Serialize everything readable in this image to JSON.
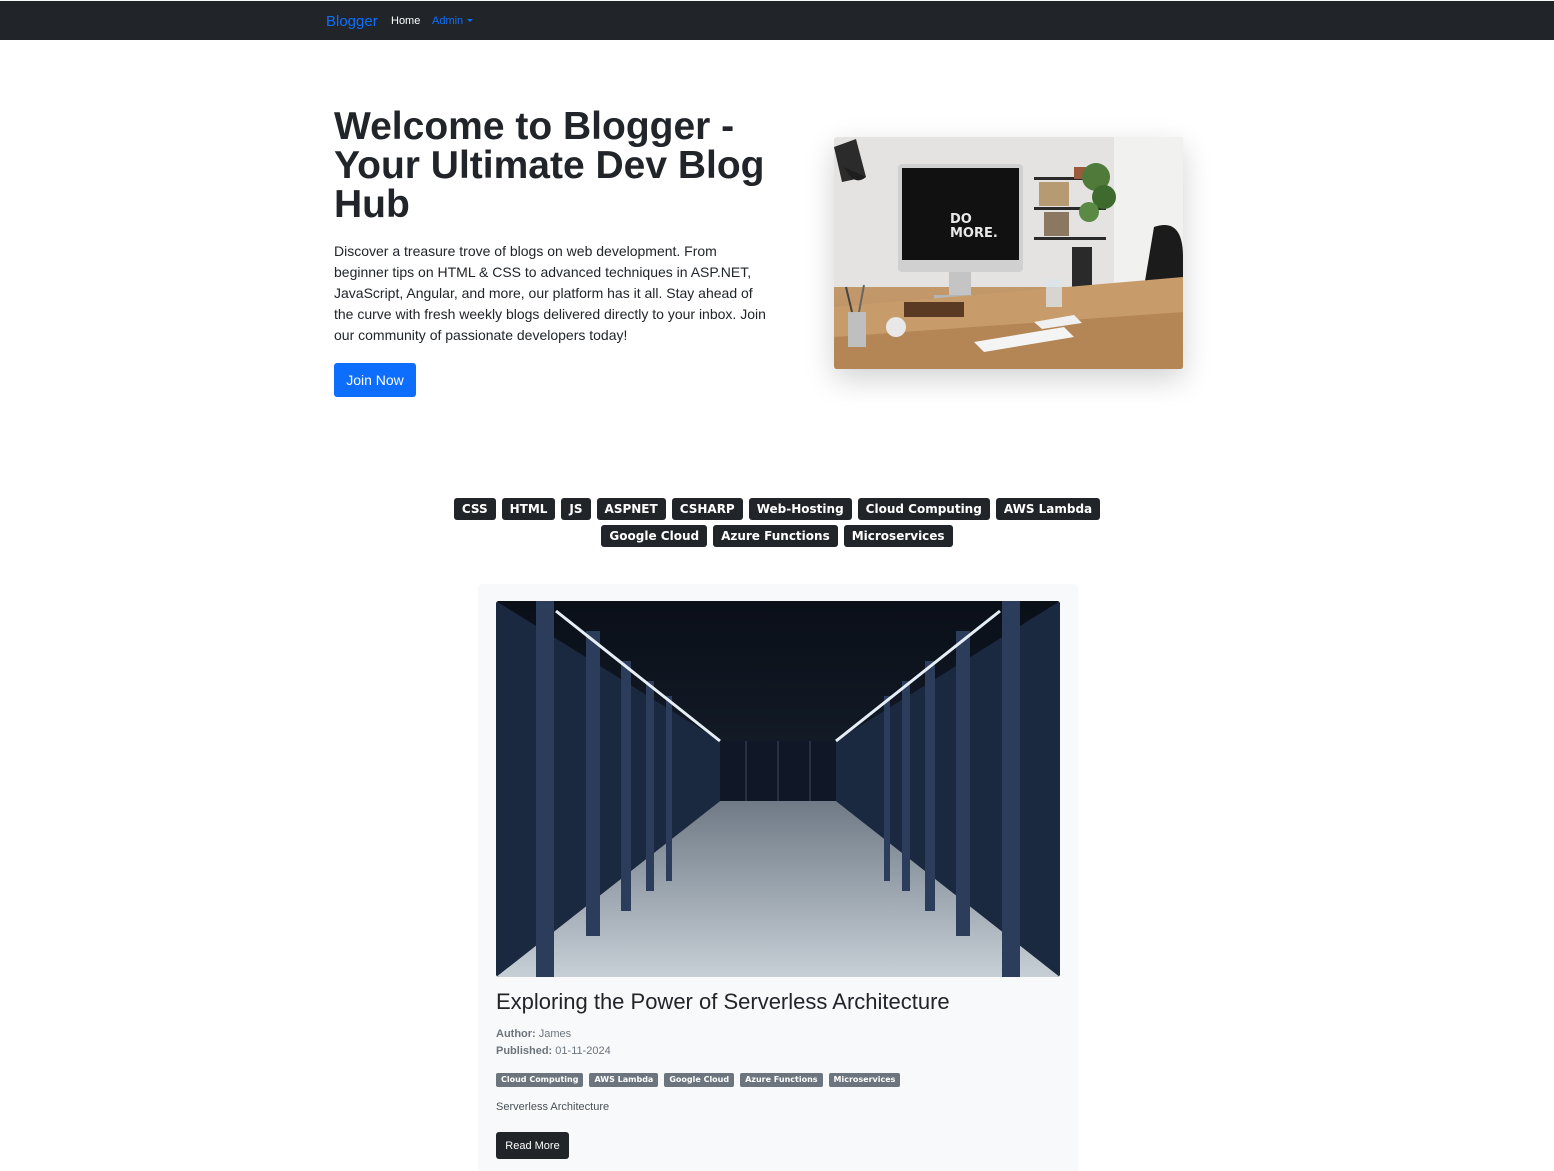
{
  "navbar": {
    "brand": "Blogger",
    "home": "Home",
    "admin": "Admin"
  },
  "hero": {
    "title": "Welcome to Blogger - Your Ultimate Dev Blog Hub",
    "text": "Discover a treasure trove of blogs on web development. From beginner tips on HTML & CSS to advanced techniques in ASP.NET, JavaScript, Angular, and more, our platform has it all. Stay ahead of the curve with fresh weekly blogs delivered directly to your inbox. Join our community of passionate developers today!",
    "button": "Join Now",
    "image_screen_text_1": "DO",
    "image_screen_text_2": "MORE."
  },
  "tags": {
    "row1": [
      "CSS",
      "HTML",
      "JS",
      "ASPNET",
      "CSHARP",
      "Web-Hosting",
      "Cloud Computing",
      "AWS Lambda"
    ],
    "row2": [
      "Google Cloud",
      "Azure Functions",
      "Microservices"
    ]
  },
  "post": {
    "title": "Exploring the Power of Serverless Architecture",
    "author_label": "Author:",
    "author": "James",
    "published_label": "Published:",
    "published": "01-11-2024",
    "tags": [
      "Cloud Computing",
      "AWS Lambda",
      "Google Cloud",
      "Azure Functions",
      "Microservices"
    ],
    "description": "Serverless Architecture",
    "button": "Read More"
  },
  "colors": {
    "navbar_bg": "#212529",
    "accent": "#0d6efd",
    "tag_bg": "#212529",
    "card_tag_bg": "#6c757d",
    "card_bg": "#f8f9fa"
  }
}
